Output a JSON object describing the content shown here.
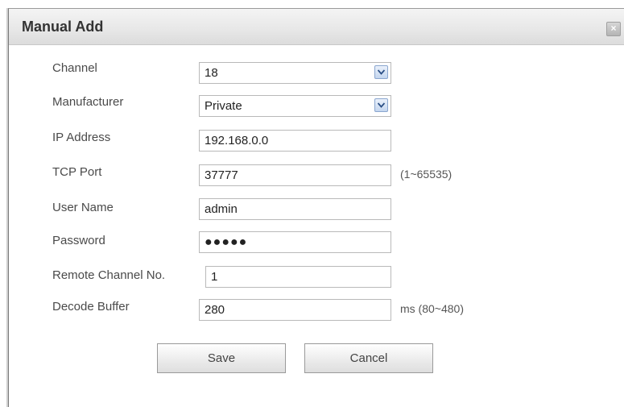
{
  "dialog": {
    "title": "Manual Add",
    "close_glyph": "×"
  },
  "form": {
    "channel": {
      "label": "Channel",
      "value": "18"
    },
    "manufacturer": {
      "label": "Manufacturer",
      "value": "Private"
    },
    "ip_address": {
      "label": "IP Address",
      "value": "192.168.0.0"
    },
    "tcp_port": {
      "label": "TCP Port",
      "value": "37777",
      "hint": "(1~65535)"
    },
    "user_name": {
      "label": "User Name",
      "value": "admin"
    },
    "password": {
      "label": "Password",
      "value": "●●●●●"
    },
    "remote_channel": {
      "label": "Remote Channel No.",
      "value": "1"
    },
    "decode_buffer": {
      "label": "Decode Buffer",
      "value": "280",
      "hint": "ms (80~480)"
    }
  },
  "buttons": {
    "save": "Save",
    "cancel": "Cancel"
  },
  "colors": {
    "titlebar": "#e7e7e7",
    "field_border": "#b9b9b9",
    "dropdown_accent": "#c4d6ef"
  }
}
